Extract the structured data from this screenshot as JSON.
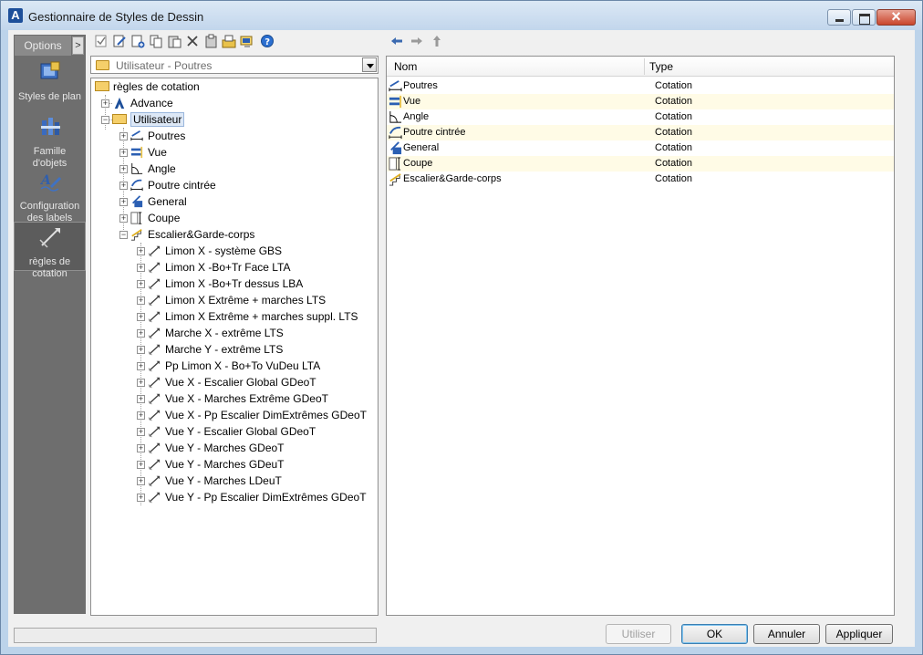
{
  "window": {
    "title": "Gestionnaire de Styles de Dessin"
  },
  "sidebar": {
    "options_label": "Options",
    "expand_label": ">",
    "items": [
      {
        "label": "Styles de plan",
        "icon": "plan-styles-icon"
      },
      {
        "label": "Famille d'objets",
        "icon": "object-family-icon"
      },
      {
        "label": "Configuration des labels",
        "icon": "label-config-icon"
      },
      {
        "label": "règles de cotation",
        "icon": "dimension-rules-icon",
        "active": true
      }
    ]
  },
  "combo": {
    "value": "Utilisateur - Poutres"
  },
  "tree": {
    "root": "règles de cotation",
    "advance": "Advance",
    "user": "Utilisateur",
    "groups": [
      "Poutres",
      "Vue",
      "Angle",
      "Poutre cintrée",
      "General",
      "Coupe",
      "Escalier&Garde-corps"
    ],
    "stairs_children": [
      "Limon X - système GBS",
      "Limon X -Bo+Tr Face LTA",
      "Limon X -Bo+Tr dessus LBA",
      "Limon X Extrême + marches LTS",
      "Limon X Extrême + marches suppl. LTS",
      "Marche X - extrême LTS",
      "Marche Y - extrême LTS",
      "Pp Limon X - Bo+To VuDeu LTA",
      "Vue X - Escalier Global GDeoT",
      "Vue X - Marches Extrême GDeoT",
      "Vue X - Pp Escalier DimExtrêmes GDeoT",
      "Vue Y - Escalier Global GDeoT",
      "Vue Y - Marches GDeoT",
      "Vue Y - Marches GDeuT",
      "Vue Y - Marches LDeuT",
      "Vue Y - Pp Escalier DimExtrêmes GDeoT"
    ]
  },
  "list": {
    "col_name": "Nom",
    "col_type": "Type",
    "rows": [
      {
        "name": "Poutres",
        "type": "Cotation"
      },
      {
        "name": "Vue",
        "type": "Cotation"
      },
      {
        "name": "Angle",
        "type": "Cotation"
      },
      {
        "name": "Poutre cintrée",
        "type": "Cotation"
      },
      {
        "name": "General",
        "type": "Cotation"
      },
      {
        "name": "Coupe",
        "type": "Cotation"
      },
      {
        "name": "Escalier&Garde-corps",
        "type": "Cotation"
      }
    ]
  },
  "buttons": {
    "use": "Utiliser",
    "ok": "OK",
    "cancel": "Annuler",
    "apply": "Appliquer"
  }
}
